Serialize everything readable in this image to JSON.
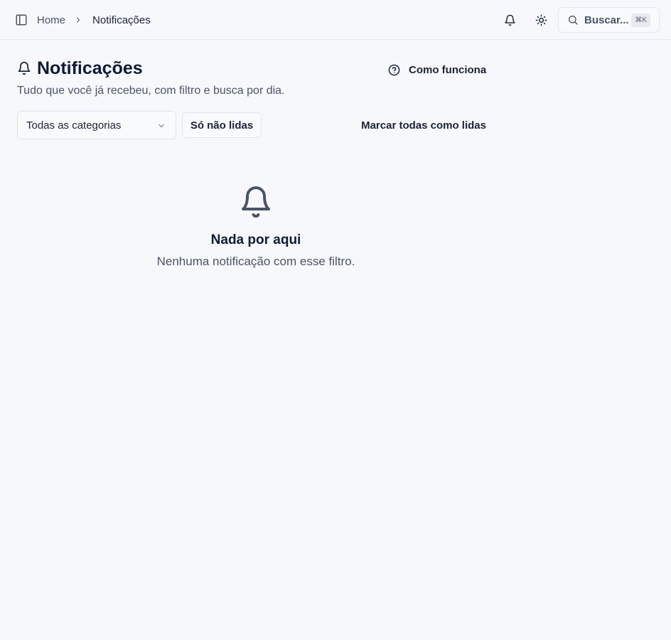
{
  "topbar": {
    "sidebar_toggle_icon": "sidebar-panel-icon",
    "breadcrumb": {
      "home": "Home",
      "separator_icon": "chevron-right-icon",
      "current": "Notificações"
    },
    "notifications_icon": "bell-icon",
    "theme_icon": "sun-icon",
    "search": {
      "placeholder": "Buscar...",
      "shortcut": "⌘K",
      "icon": "search-icon"
    }
  },
  "header": {
    "icon": "bell-icon",
    "title": "Notificações",
    "subtitle": "Tudo que você já recebeu, com filtro e busca por dia.",
    "help_link": {
      "icon": "help-circle-icon",
      "label": "Como funciona"
    }
  },
  "filters": {
    "category_select": {
      "selected": "Todas as categorias",
      "icon": "chevron-down-icon"
    },
    "unread_only_label": "Só não lidas",
    "mark_all_read_label": "Marcar todas como lidas"
  },
  "empty_state": {
    "icon": "bell-icon",
    "title": "Nada por aqui",
    "description": "Nenhuma notificação com esse filtro."
  },
  "colors": {
    "background": "#f7f8fc",
    "text_primary": "#0f1b33",
    "text_secondary": "#4a5468",
    "border": "#e2e5ec"
  }
}
